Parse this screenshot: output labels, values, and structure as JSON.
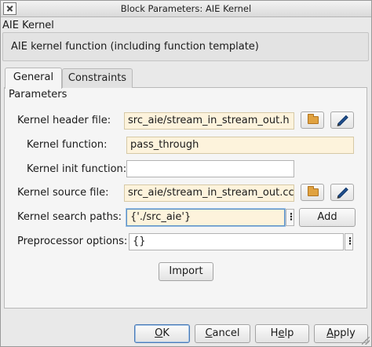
{
  "window": {
    "title": "Block Parameters: AIE Kernel"
  },
  "block": {
    "name": "AIE Kernel",
    "description": "AIE kernel function (including function template)"
  },
  "tabs": [
    {
      "label": "General",
      "active": true
    },
    {
      "label": "Constraints",
      "active": false
    }
  ],
  "parameters": {
    "group_label": "Parameters",
    "kernel_header_file": {
      "label": "Kernel header file:",
      "value": "src_aie/stream_in_stream_out.h"
    },
    "kernel_function": {
      "label": "Kernel function:",
      "value": "pass_through"
    },
    "kernel_init_function": {
      "label": "Kernel init function:",
      "value": ""
    },
    "kernel_source_file": {
      "label": "Kernel source file:",
      "value": "src_aie/stream_in_stream_out.cc"
    },
    "kernel_search_paths": {
      "label": "Kernel search paths:",
      "value": "{'./src_aie'}",
      "add_label": "Add"
    },
    "preprocessor_options": {
      "label": "Preprocessor options:",
      "value": "{}"
    }
  },
  "import_label": "Import",
  "footer": {
    "ok_mnemonic": "O",
    "ok_rest": "K",
    "cancel_mnemonic": "C",
    "cancel_rest": "ancel",
    "help_first": "H",
    "help_mnemonic": "e",
    "help_rest": "lp",
    "apply_mnemonic": "A",
    "apply_rest": "pply"
  },
  "colors": {
    "highlight_field": "#fdf3dc",
    "focus_border": "#5a8fc4",
    "folder_icon": "#e0a240",
    "pencil_icon": "#1f4f8f"
  },
  "icons": [
    "app-icon",
    "folder-icon",
    "pencil-icon",
    "ellipsis-icon",
    "resize-grip-icon"
  ]
}
